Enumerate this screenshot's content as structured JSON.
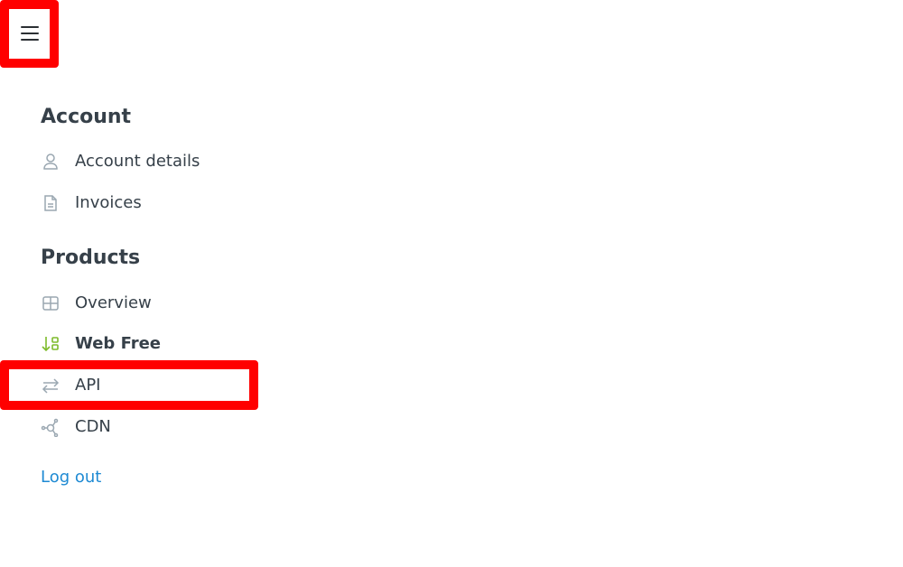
{
  "menu": {
    "toggle_icon": "hamburger-icon"
  },
  "account": {
    "heading": "Account",
    "items": [
      {
        "label": "Account details",
        "icon": "user-icon"
      },
      {
        "label": "Invoices",
        "icon": "document-icon"
      }
    ]
  },
  "products": {
    "heading": "Products",
    "items": [
      {
        "label": "Overview",
        "icon": "grid-icon"
      },
      {
        "label": "Web Free",
        "icon": "sort-down-icon",
        "active": true
      },
      {
        "label": "API",
        "icon": "swap-arrows-icon"
      },
      {
        "label": "CDN",
        "icon": "network-icon"
      }
    ]
  },
  "logout": {
    "label": "Log out"
  },
  "colors": {
    "text": "#364049",
    "icon": "#9aa7b1",
    "active_icon": "#7dbb2a",
    "link": "#1e8ad3",
    "highlight": "#ff0000"
  }
}
